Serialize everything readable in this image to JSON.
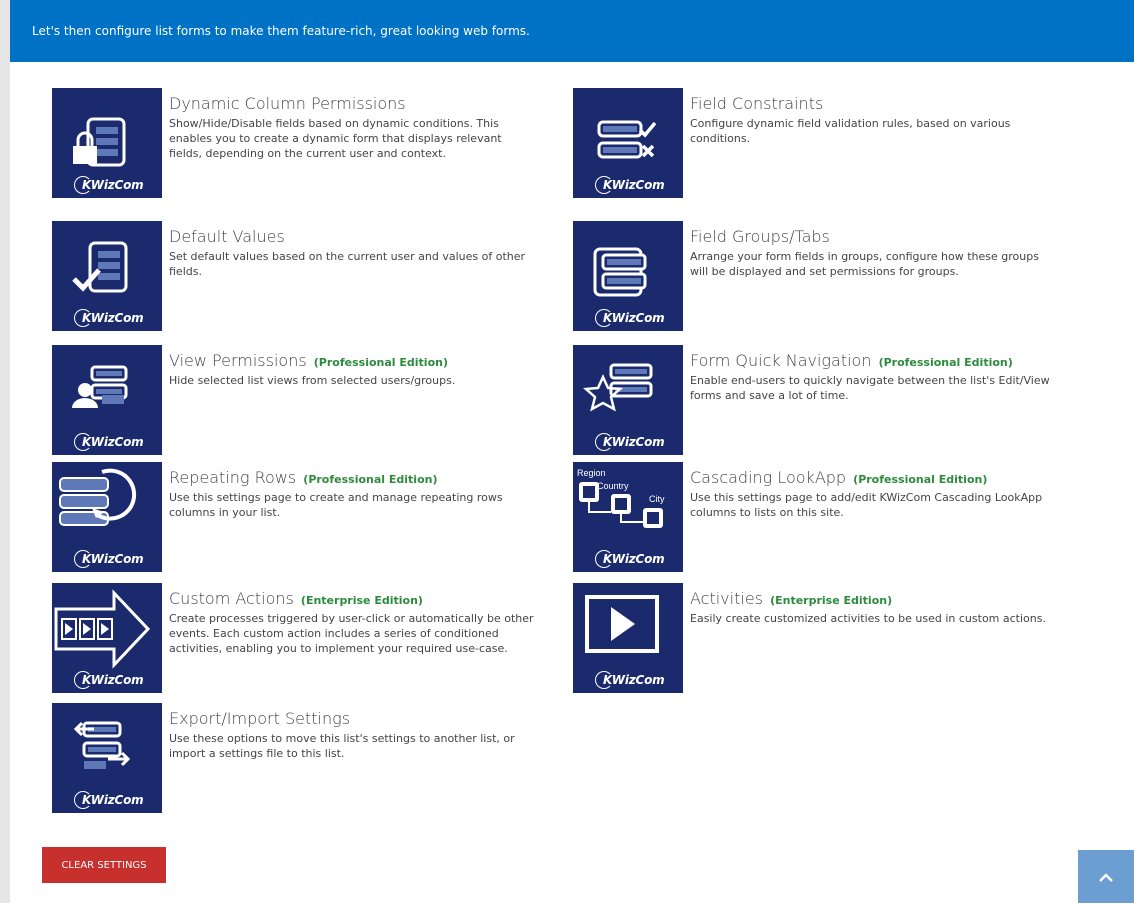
{
  "banner": {
    "text": "Let's then configure list forms to make them feature-rich, great looking web forms."
  },
  "brand_label": "KWizCom",
  "tiles": [
    {
      "title": "Dynamic Column Permissions",
      "edition": "",
      "description": "Show/Hide/Disable fields based on dynamic conditions. This enables you to create a dynamic form that displays relevant fields, depending on the current user and context.",
      "icon": "lock-list-icon"
    },
    {
      "title": "Field Constraints",
      "edition": "",
      "description": "Configure dynamic field validation rules, based on various conditions.",
      "icon": "check-x-fields-icon"
    },
    {
      "title": "Default Values",
      "edition": "",
      "description": "Set default values based on the current user and values of other fields.",
      "icon": "checkmark-list-icon"
    },
    {
      "title": "Field Groups/Tabs",
      "edition": "",
      "description": "Arrange your form fields in groups, configure how these groups will be displayed and set permissions for groups.",
      "icon": "grouped-fields-icon"
    },
    {
      "title": "View Permissions",
      "edition": "(Professional Edition)",
      "description": "Hide selected list views from selected users/groups.",
      "icon": "user-list-icon"
    },
    {
      "title": "Form Quick Navigation",
      "edition": "(Professional Edition)",
      "description": "Enable end-users to quickly navigate between the list's Edit/View forms and save a lot of time.",
      "icon": "star-list-icon"
    },
    {
      "title": "Repeating Rows",
      "edition": "(Professional Edition)",
      "description": "Use this settings page to create and manage repeating rows columns in your list.",
      "icon": "repeat-rows-icon"
    },
    {
      "title": "Cascading LookApp",
      "edition": "(Professional Edition)",
      "description": "Use this settings page to add/edit KWizCom Cascading LookApp columns to lists on this site.",
      "icon": "cascading-lookup-icon",
      "icon_labels": [
        "Region",
        "Country",
        "City"
      ]
    },
    {
      "title": "Custom Actions",
      "edition": "(Enterprise Edition)",
      "description": "Create processes triggered by user-click or automatically be other events. Each custom action includes a series of conditioned activities, enabling you to implement your required use-case.",
      "icon": "arrow-play-icon"
    },
    {
      "title": "Activities",
      "edition": "(Enterprise Edition)",
      "description": "Easily create customized activities to be used in custom actions.",
      "icon": "play-icon"
    },
    {
      "title": "Export/Import Settings",
      "edition": "",
      "description": "Use these options to move this list's settings to another list, or import a settings file to this list.",
      "icon": "export-import-icon"
    }
  ],
  "clear_button": {
    "label": "CLEAR SETTINGS"
  },
  "scroll_top": {
    "icon": "chevron-up-icon"
  },
  "colors": {
    "banner": "#0072c6",
    "icon_bg": "#1a2a6c",
    "edition": "#2e8b3e",
    "clear": "#c8302d",
    "scroll_top": "#6c9ed1"
  }
}
